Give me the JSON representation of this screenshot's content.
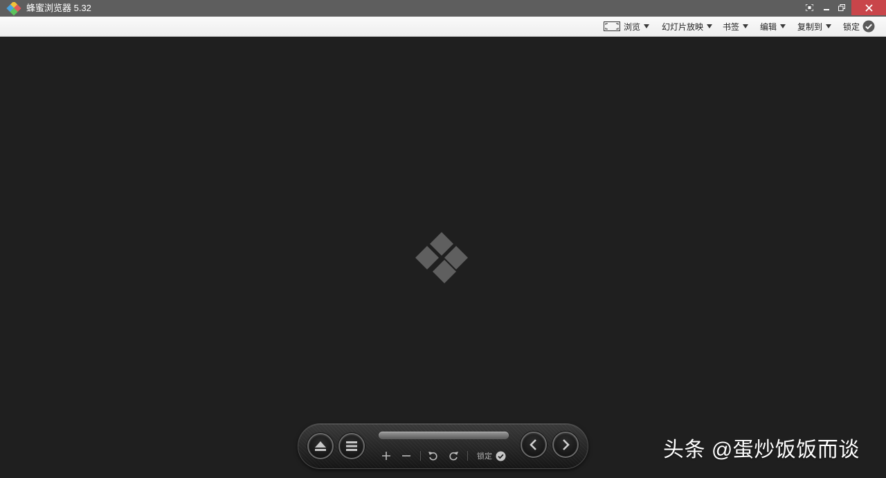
{
  "window": {
    "title": "蜂蜜浏览器 5.32",
    "controls": {
      "capture_icon": "capture-icon",
      "minimize_icon": "minimize-icon",
      "restore_icon": "restore-icon",
      "close_icon": "close-icon"
    },
    "close_color": "#c9454a"
  },
  "toolbar": {
    "browse": "浏览",
    "slideshow": "幻灯片放映",
    "bookmark": "书签",
    "edit": "编辑",
    "copy_to": "复制到",
    "lock": "锁定"
  },
  "viewer": {
    "background": "#1f1f1f",
    "placeholder_icon": "diamond-logo-icon"
  },
  "control_bar": {
    "eject_icon": "eject-icon",
    "menu_icon": "menu-icon",
    "zoom_in_icon": "plus-icon",
    "zoom_out_icon": "minus-icon",
    "rotate_left_icon": "rotate-left-icon",
    "rotate_right_icon": "rotate-right-icon",
    "lock_label": "锁定",
    "prev_icon": "chevron-left-icon",
    "next_icon": "chevron-right-icon"
  },
  "watermark": {
    "text": "头条 @蛋炒饭饭而谈"
  }
}
